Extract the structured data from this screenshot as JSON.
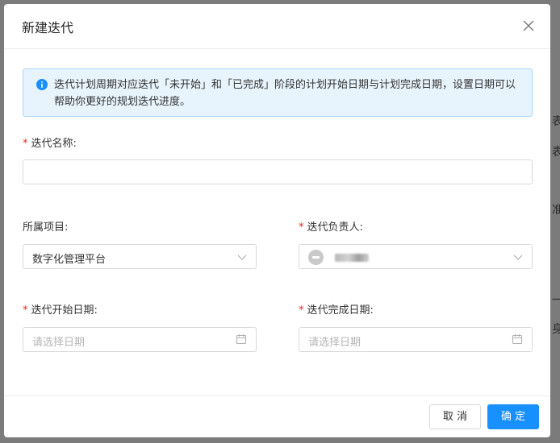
{
  "background_edge": [
    "表",
    "表",
    "准",
    "一",
    "身"
  ],
  "dialog": {
    "title": "新建迭代",
    "close_icon": "close-icon",
    "notice": "迭代计划周期对应迭代「未开始」和「已完成」阶段的计划开始日期与计划完成日期，设置日期可以帮助你更好的规划迭代进度。",
    "fields": {
      "name": {
        "required_mark": "*",
        "label": "迭代名称:",
        "value": ""
      },
      "project": {
        "label": "所属项目:",
        "value": "数字化管理平台"
      },
      "owner": {
        "required_mark": "*",
        "label": "迭代负责人:",
        "value": ""
      },
      "start_date": {
        "required_mark": "*",
        "label": "迭代开始日期:",
        "placeholder": "请选择日期"
      },
      "end_date": {
        "required_mark": "*",
        "label": "迭代完成日期:",
        "placeholder": "请选择日期"
      }
    },
    "buttons": {
      "cancel": "取 消",
      "ok": "确 定"
    }
  },
  "colors": {
    "primary": "#1890ff",
    "required": "#f5222d",
    "notice_bg": "#e8f4fd",
    "notice_border": "#a8d5f7"
  }
}
